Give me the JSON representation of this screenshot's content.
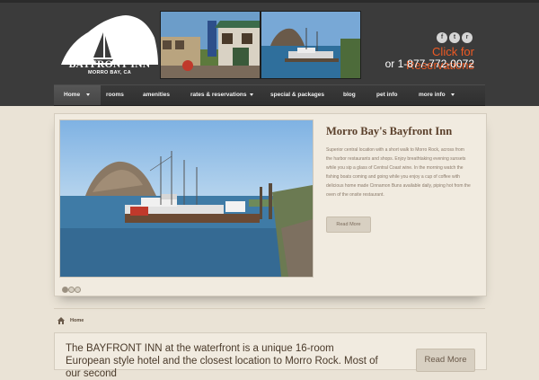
{
  "header": {
    "logo_name": "BAYFRONT INN",
    "logo_sub": "MORRO BAY, CA",
    "social": [
      {
        "icon": "facebook-icon",
        "glyph": "f"
      },
      {
        "icon": "twitter-icon",
        "glyph": "t"
      },
      {
        "icon": "rss-icon",
        "glyph": "r"
      }
    ],
    "reservation_link": "Click for Reservations",
    "phone": "or 1-877-772-0072",
    "colors": {
      "background": "#3b3b3b",
      "reservation_link": "#ee5a24"
    }
  },
  "nav": {
    "items": [
      {
        "label": "Home",
        "has_dropdown": true,
        "active": true
      },
      {
        "label": "rooms",
        "has_dropdown": false
      },
      {
        "label": "amenities",
        "has_dropdown": false
      },
      {
        "label": "rates & reservations",
        "has_dropdown": true
      },
      {
        "label": "special & packages",
        "has_dropdown": false
      },
      {
        "label": "blog",
        "has_dropdown": false
      },
      {
        "label": "pet info",
        "has_dropdown": false
      },
      {
        "label": "more info",
        "has_dropdown": true
      }
    ]
  },
  "slider": {
    "title": "Morro Bay's Bayfront Inn",
    "text": "Superior central location with a short walk to Morro Rock, across from the harbor restaurants and shops. Enjoy breathtaking evening sunsets while you sip a glass of Central Coast wine. In the morning watch the fishing boats coming and going while you enjoy a cup of coffee with delicious home made Cinnamon Buns available daily, piping hot from the oven of the onsite restaurant.",
    "button_label": "Read More",
    "dots_count": 3,
    "active_dot": 1
  },
  "breadcrumb": {
    "home": "Home"
  },
  "intro": {
    "text": "The BAYFRONT INN at the waterfront is a unique 16-room European style hotel and the closest location to Morro Rock. Most of our second",
    "button_label": "Read More"
  }
}
